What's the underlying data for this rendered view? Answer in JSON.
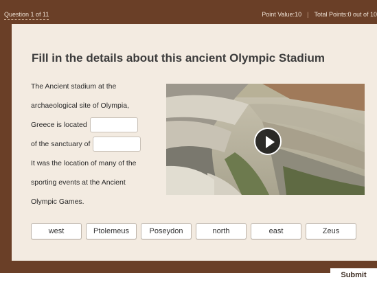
{
  "header": {
    "question_counter": "Question 1 of 11",
    "point_value": "Point Value:10",
    "separator": "|",
    "total_points": "Total Points:0 out of 10"
  },
  "question": {
    "title": "Fill in the details about this ancient Olympic Stadium",
    "passage": {
      "line1": "The Ancient stadium at the",
      "line2": "archaeological site of Olympia,",
      "line3": "Greece is located",
      "line4": "of the sanctuary of",
      "line5": "It was the location of many of the",
      "line6": "sporting events at the Ancient",
      "line7": "Olympic Games."
    },
    "blanks": [
      "",
      ""
    ]
  },
  "media": {
    "icon": "play-icon"
  },
  "choices": [
    "west",
    "Ptolemeus",
    "Poseydon",
    "north",
    "east",
    "Zeus"
  ],
  "footer": {
    "submit_label": "Submit"
  },
  "colors": {
    "frame": "#6a3f27",
    "card": "#f3ebe1",
    "title": "#3b3b3b"
  }
}
